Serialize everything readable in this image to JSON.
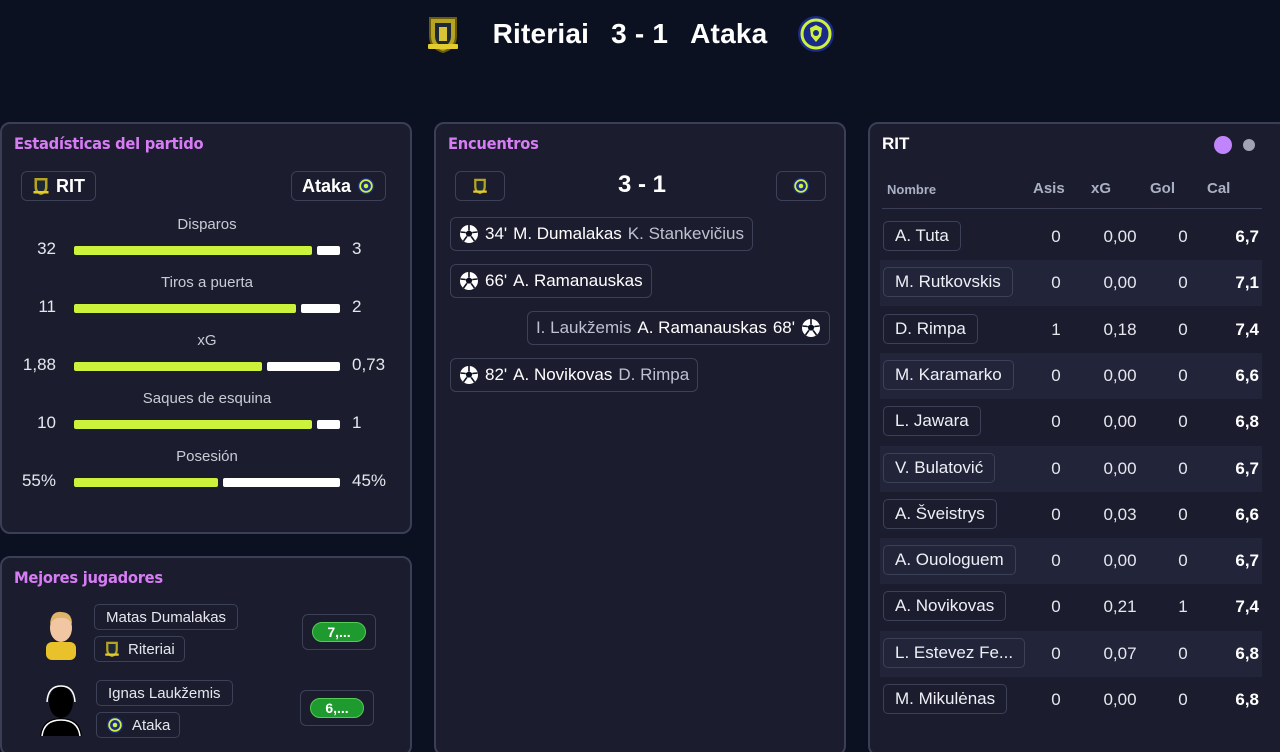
{
  "header": {
    "home_team": "Riteriai",
    "score": "3 - 1",
    "away_team": "Ataka"
  },
  "colors": {
    "accent_purple": "#d77cf5",
    "lime": "#cdf23c",
    "rating_green": "#1e9a2e",
    "background": "#0b1120",
    "panel": "#1b1d2e"
  },
  "stats": {
    "title": "Estadísticas del partido",
    "home_label": "RIT",
    "away_label": "Ataka",
    "rows": [
      {
        "label": "Disparos",
        "home": "32",
        "away": "3",
        "home_share": 0.91
      },
      {
        "label": "Tiros a puerta",
        "home": "11",
        "away": "2",
        "home_share": 0.85
      },
      {
        "label": "xG",
        "home": "1,88",
        "away": "0,73",
        "home_share": 0.72
      },
      {
        "label": "Saques de esquina",
        "home": "10",
        "away": "1",
        "home_share": 0.91
      },
      {
        "label": "Posesión",
        "home": "55%",
        "away": "45%",
        "home_share": 0.55
      }
    ]
  },
  "best_players": {
    "title": "Mejores jugadores",
    "players": [
      {
        "name": "Matas Dumalakas",
        "team": "Riteriai",
        "rating": "7,..."
      },
      {
        "name": "Ignas Laukžemis",
        "team": "Ataka",
        "rating": "6,..."
      }
    ]
  },
  "events": {
    "title": "Encuentros",
    "score": "3 - 1",
    "items": [
      {
        "minute": "34'",
        "scorer": "M. Dumalakas",
        "assist": "K. Stankevičius",
        "side": "home"
      },
      {
        "minute": "66'",
        "scorer": "A. Ramanauskas",
        "assist": "",
        "side": "home"
      },
      {
        "minute": "68'",
        "scorer": "A. Ramanauskas",
        "assist": "I. Laukžemis",
        "side": "away"
      },
      {
        "minute": "82'",
        "scorer": "A. Novikovas",
        "assist": "D. Rimpa",
        "side": "home"
      }
    ]
  },
  "lineup": {
    "title": "RIT",
    "headers": {
      "name": "Nombre",
      "asis": "Asis",
      "xg": "xG",
      "gol": "Gol",
      "cal": "Cal"
    },
    "rows": [
      {
        "name": "A. Tuta",
        "asis": "0",
        "xg": "0,00",
        "gol": "0",
        "cal": "6,7"
      },
      {
        "name": "M. Rutkovskis",
        "asis": "0",
        "xg": "0,00",
        "gol": "0",
        "cal": "7,1"
      },
      {
        "name": "D. Rimpa",
        "asis": "1",
        "xg": "0,18",
        "gol": "0",
        "cal": "7,4"
      },
      {
        "name": "M. Karamarko",
        "asis": "0",
        "xg": "0,00",
        "gol": "0",
        "cal": "6,6"
      },
      {
        "name": "L. Jawara",
        "asis": "0",
        "xg": "0,00",
        "gol": "0",
        "cal": "6,8"
      },
      {
        "name": "V. Bulatović",
        "asis": "0",
        "xg": "0,00",
        "gol": "0",
        "cal": "6,7"
      },
      {
        "name": "A. Šveistrys",
        "asis": "0",
        "xg": "0,03",
        "gol": "0",
        "cal": "6,6"
      },
      {
        "name": "A. Ouologuem",
        "asis": "0",
        "xg": "0,00",
        "gol": "0",
        "cal": "6,7"
      },
      {
        "name": "A. Novikovas",
        "asis": "0",
        "xg": "0,21",
        "gol": "1",
        "cal": "7,4"
      },
      {
        "name": "L. Estevez Fe...",
        "asis": "0",
        "xg": "0,07",
        "gol": "0",
        "cal": "6,8"
      },
      {
        "name": "M. Mikulėnas",
        "asis": "0",
        "xg": "0,00",
        "gol": "0",
        "cal": "6,8"
      }
    ]
  }
}
